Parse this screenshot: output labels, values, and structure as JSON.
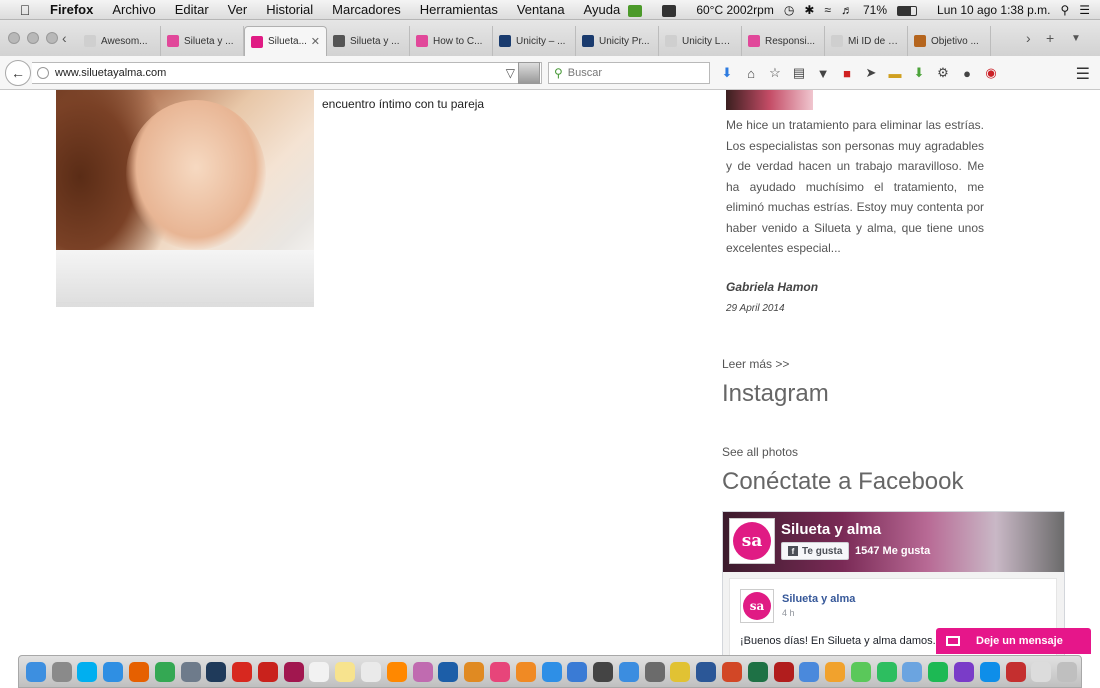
{
  "menubar": {
    "app_name": "Firefox",
    "menus": [
      "Archivo",
      "Editar",
      "Ver",
      "Historial",
      "Marcadores",
      "Herramientas",
      "Ventana",
      "Ayuda"
    ],
    "temp_status": "60°C 2002rpm",
    "battery": "71%",
    "datetime": "Lun 10 ago  1:38 p.m."
  },
  "tabs": [
    {
      "title": "Awesom...",
      "color": "#cfcfcf"
    },
    {
      "title": "Silueta y ...",
      "color": "#e1489a"
    },
    {
      "title": "Silueta...",
      "color": "#e01b84"
    },
    {
      "title": "Silueta y ...",
      "color": "#555555"
    },
    {
      "title": "How to C...",
      "color": "#e1489a"
    },
    {
      "title": "Unicity – ...",
      "color": "#1a3b6e"
    },
    {
      "title": "Unicity Pr...",
      "color": "#1a3b6e"
    },
    {
      "title": "Unicity Latino...",
      "color": "#cfcfcf"
    },
    {
      "title": "Responsi...",
      "color": "#e1489a"
    },
    {
      "title": "Mi ID de usua...",
      "color": "#cfcfcf"
    },
    {
      "title": "Objetivo ...",
      "color": "#b5651d"
    }
  ],
  "navbar": {
    "url": "www.siluetayalma.com",
    "search_placeholder": "Buscar"
  },
  "page": {
    "intro_text": "encuentro íntimo con tu pareja",
    "testimonial": {
      "text": "Me hice un tratamiento para eliminar las estrías. Los especialistas son personas muy agradables y de verdad hacen un trabajo maravilloso. Me ha ayudado muchísimo el tratamiento, me eliminó muchas estrías. Estoy muy contenta por haber venido a Silueta y alma, que tiene unos excelentes especial...",
      "author": "Gabriela Hamon",
      "date": "29 April 2014"
    },
    "read_more": "Leer más >>",
    "instagram_heading": "Instagram",
    "see_all_photos": "See all photos",
    "facebook_heading": "Conéctate a Facebook",
    "facebook": {
      "page_name": "Silueta y alma",
      "like_button": "Te gusta",
      "likes": "1547 Me gusta",
      "post_author": "Silueta y alma",
      "post_time": "4 h",
      "post_text": "¡Buenos días! En Silueta y alma damos...",
      "logo_text": "sa"
    },
    "message_button": "Deje un mensaje"
  },
  "dock": {
    "apps": [
      {
        "name": "finder",
        "color": "#3d8fe0"
      },
      {
        "name": "launchpad",
        "color": "#8a8a8a"
      },
      {
        "name": "skype",
        "color": "#00aff0"
      },
      {
        "name": "safari",
        "color": "#2f8fe3"
      },
      {
        "name": "firefox",
        "color": "#e66000"
      },
      {
        "name": "chrome",
        "color": "#34a853"
      },
      {
        "name": "image-capture",
        "color": "#6e7b8b"
      },
      {
        "name": "photoshop",
        "color": "#1f3a5a"
      },
      {
        "name": "acrobat",
        "color": "#d7281f"
      },
      {
        "name": "acrobat-reader",
        "color": "#c9221c"
      },
      {
        "name": "indesign",
        "color": "#a1174f"
      },
      {
        "name": "calendar",
        "color": "#f2f2f2"
      },
      {
        "name": "notes",
        "color": "#f7e38e"
      },
      {
        "name": "textedit",
        "color": "#eaeaea"
      },
      {
        "name": "vlc",
        "color": "#ff8800"
      },
      {
        "name": "photo-app",
        "color": "#c06bb0"
      },
      {
        "name": "quicktime",
        "color": "#1c5ea8"
      },
      {
        "name": "vuze",
        "color": "#e08a22"
      },
      {
        "name": "itunes",
        "color": "#e7457a"
      },
      {
        "name": "ibooks",
        "color": "#f08a24"
      },
      {
        "name": "appstore",
        "color": "#2e8fe6"
      },
      {
        "name": "sync",
        "color": "#3a7bd5"
      },
      {
        "name": "final-cut",
        "color": "#444444"
      },
      {
        "name": "downloads",
        "color": "#3b8de0"
      },
      {
        "name": "disk-utility",
        "color": "#6b6b6b"
      },
      {
        "name": "radiation",
        "color": "#e1c233"
      },
      {
        "name": "word",
        "color": "#2b5797"
      },
      {
        "name": "powerpoint",
        "color": "#d24726"
      },
      {
        "name": "excel",
        "color": "#1e7145"
      },
      {
        "name": "filezilla",
        "color": "#b11d1d"
      },
      {
        "name": "preview",
        "color": "#4a89dc"
      },
      {
        "name": "pages",
        "color": "#f1a22d"
      },
      {
        "name": "messages",
        "color": "#5ac85a"
      },
      {
        "name": "evernote",
        "color": "#2dbe60"
      },
      {
        "name": "globe",
        "color": "#6ba4e0"
      },
      {
        "name": "spotify",
        "color": "#1db954"
      },
      {
        "name": "screen-share",
        "color": "#7a3cc8"
      },
      {
        "name": "teamviewer",
        "color": "#0e8ee9"
      },
      {
        "name": "pdf-tool",
        "color": "#c42f2f"
      },
      {
        "name": "documents",
        "color": "#dcdcdc"
      },
      {
        "name": "trash",
        "color": "#bfbfbf"
      }
    ]
  }
}
